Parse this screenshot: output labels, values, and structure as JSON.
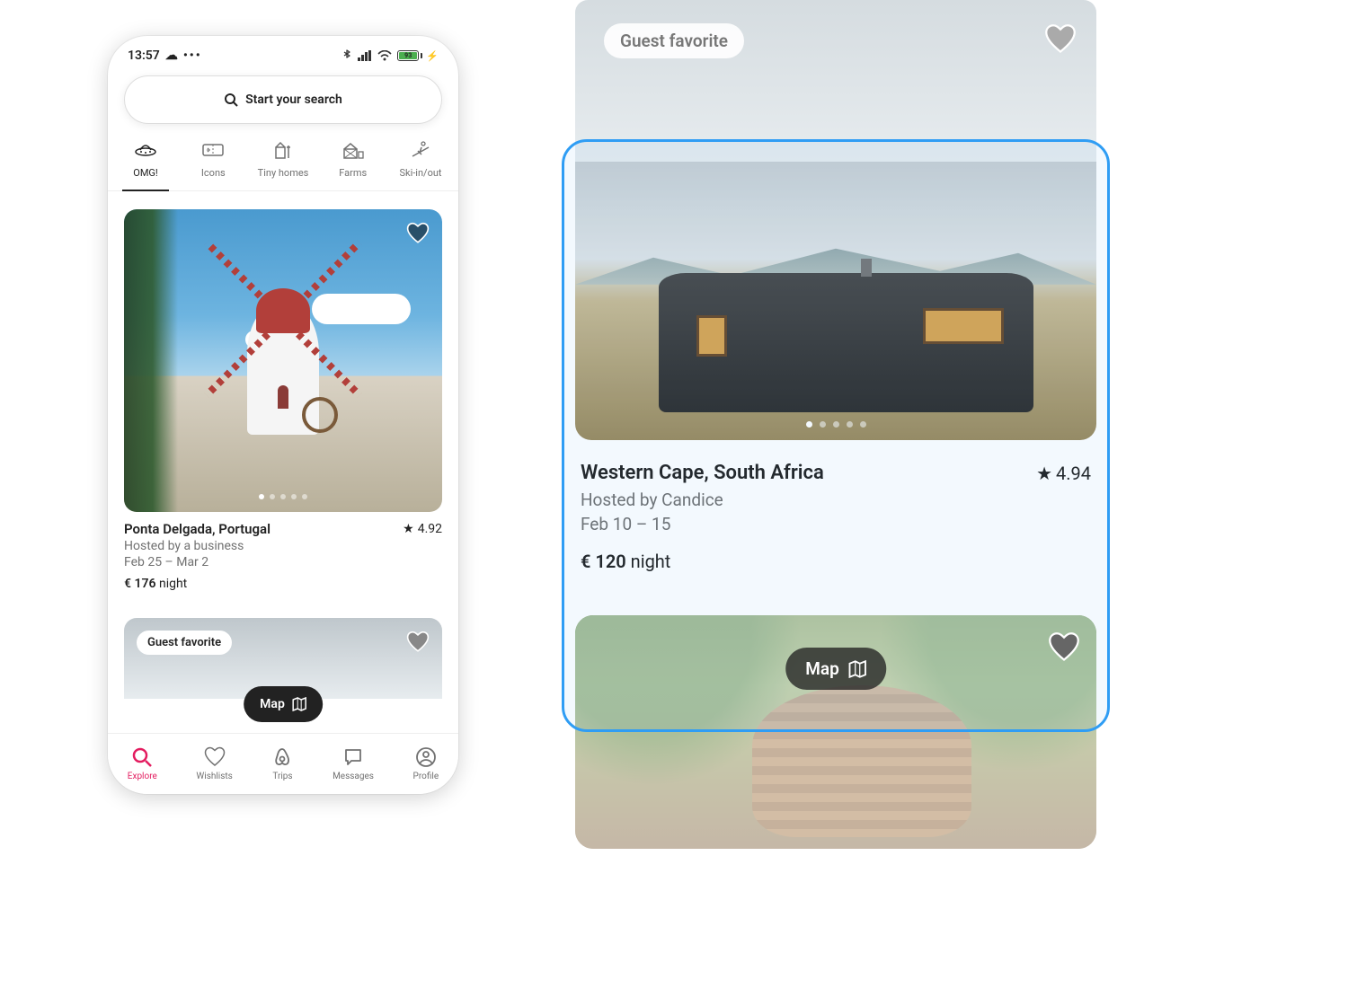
{
  "status": {
    "time": "13:57",
    "battery": "93"
  },
  "search": {
    "placeholder": "Start your search"
  },
  "categories": [
    {
      "label": "OMG!",
      "active": true
    },
    {
      "label": "Icons"
    },
    {
      "label": "Tiny homes"
    },
    {
      "label": "Farms"
    },
    {
      "label": "Ski-in/out"
    }
  ],
  "listings": [
    {
      "location": "Ponta Delgada, Portugal",
      "rating": "4.92",
      "host": "Hosted by a business",
      "dates": "Feb 25 – Mar 2",
      "price": "€ 176",
      "price_unit": "night"
    },
    {
      "badge": "Guest favorite"
    }
  ],
  "map_label": "Map",
  "nav": [
    {
      "label": "Explore",
      "active": true
    },
    {
      "label": "Wishlists"
    },
    {
      "label": "Trips"
    },
    {
      "label": "Messages"
    },
    {
      "label": "Profile"
    }
  ],
  "detail": {
    "badge": "Guest favorite",
    "location": "Western Cape, South Africa",
    "rating": "4.94",
    "host": "Hosted by Candice",
    "dates": "Feb 10 – 15",
    "price": "€ 120",
    "price_unit": "night",
    "map_label": "Map"
  }
}
